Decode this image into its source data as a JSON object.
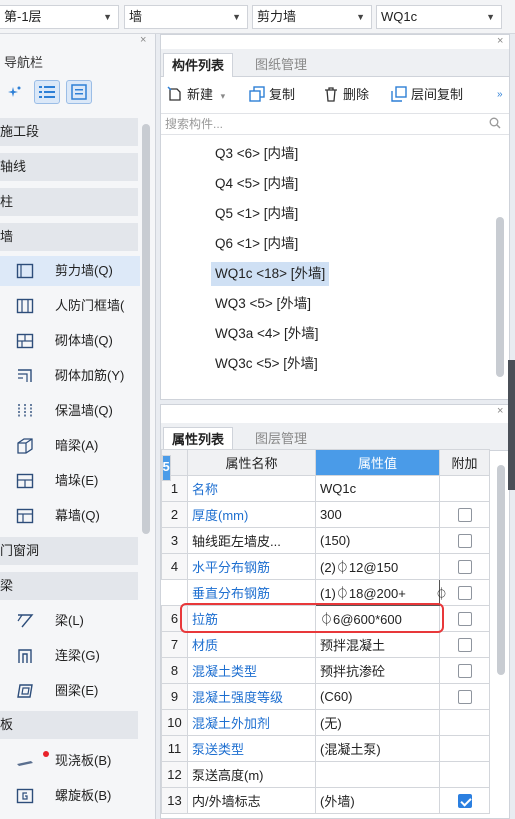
{
  "toolbar": {
    "floor": "第-1层",
    "category": "墙",
    "type": "剪力墙",
    "component": "WQ1c"
  },
  "nav": {
    "title": "导航栏",
    "close": "×",
    "tools": [
      "sparkle-icon",
      "list-icon",
      "detail-list-icon"
    ],
    "groups": [
      {
        "label": "施工段",
        "items": []
      },
      {
        "label": "轴线",
        "items": []
      },
      {
        "label": "柱",
        "items": []
      },
      {
        "label": "墙",
        "items": [
          {
            "label": "剪力墙(Q)",
            "icon": "shear-wall-icon",
            "active": true
          },
          {
            "label": "人防门框墙(",
            "icon": "blast-door-wall-icon"
          },
          {
            "label": "砌体墙(Q)",
            "icon": "masonry-wall-icon"
          },
          {
            "label": "砌体加筋(Y)",
            "icon": "masonry-rebar-icon"
          },
          {
            "label": "保温墙(Q)",
            "icon": "insulation-wall-icon"
          },
          {
            "label": "暗梁(A)",
            "icon": "hidden-beam-icon"
          },
          {
            "label": "墙垛(E)",
            "icon": "wall-pier-icon"
          },
          {
            "label": "幕墙(Q)",
            "icon": "curtain-wall-icon"
          }
        ]
      },
      {
        "label": "门窗洞",
        "items": []
      },
      {
        "label": "梁",
        "items": [
          {
            "label": "梁(L)",
            "icon": "beam-icon"
          },
          {
            "label": "连梁(G)",
            "icon": "coupling-beam-icon"
          },
          {
            "label": "圈梁(E)",
            "icon": "ring-beam-icon"
          }
        ]
      },
      {
        "label": "板",
        "items": [
          {
            "label": "现浇板(B)",
            "icon": "cast-slab-icon"
          },
          {
            "label": "螺旋板(B)",
            "icon": "spiral-slab-icon"
          }
        ]
      }
    ]
  },
  "components": {
    "tabs": [
      "构件列表",
      "图纸管理"
    ],
    "tools": {
      "new": "新建",
      "copy": "复制",
      "delete": "删除",
      "floor_copy": "层间复制"
    },
    "search_placeholder": "搜索构件...",
    "items": [
      {
        "label": "Q3 <6> [内墙]"
      },
      {
        "label": "Q4 <5> [内墙]"
      },
      {
        "label": "Q5 <1> [内墙]"
      },
      {
        "label": "Q6 <1> [内墙]"
      },
      {
        "label": "WQ1c <18> [外墙]",
        "active": true
      },
      {
        "label": "WQ3 <5> [外墙]"
      },
      {
        "label": "WQ3a <4> [外墙]"
      },
      {
        "label": "WQ3c <5> [外墙]"
      }
    ]
  },
  "properties": {
    "tabs": [
      "属性列表",
      "图层管理"
    ],
    "headers": [
      "属性名称",
      "属性值",
      "附加"
    ],
    "rows": [
      {
        "num": "1",
        "name": "名称",
        "value": "WQ1c",
        "blue": true,
        "check": null
      },
      {
        "num": "2",
        "name": "厚度(mm)",
        "value": "300",
        "blue": true,
        "check": false
      },
      {
        "num": "3",
        "name": "轴线距左墙皮...",
        "value": "(150)",
        "blue": false,
        "check": false
      },
      {
        "num": "4",
        "name": "水平分布钢筋",
        "value": "(2)⏀12@150",
        "blue": true,
        "check": false
      },
      {
        "num": "5",
        "name": "垂直分布钢筋",
        "value": "(1)⏀18@200+",
        "blue": true,
        "check": false,
        "extra": "⏀",
        "selected": true
      },
      {
        "num": "6",
        "name": "拉筋",
        "value": "⏀6@600*600",
        "blue": true,
        "check": false
      },
      {
        "num": "7",
        "name": "材质",
        "value": "预拌混凝土",
        "blue": true,
        "check": false
      },
      {
        "num": "8",
        "name": "混凝土类型",
        "value": "预拌抗渗砼",
        "blue": true,
        "check": false
      },
      {
        "num": "9",
        "name": "混凝土强度等级",
        "value": "(C60)",
        "blue": true,
        "check": false
      },
      {
        "num": "10",
        "name": "混凝土外加剂",
        "value": "(无)",
        "blue": true,
        "check": null
      },
      {
        "num": "11",
        "name": "泵送类型",
        "value": "(混凝土泵)",
        "blue": true,
        "check": null
      },
      {
        "num": "12",
        "name": "泵送高度(m)",
        "value": "",
        "blue": false,
        "check": null
      },
      {
        "num": "13",
        "name": "内/外墙标志",
        "value": "(外墙)",
        "blue": false,
        "check": true
      }
    ]
  },
  "colors": {
    "accent": "#4a9be8",
    "highlight": "#e8383a",
    "link": "#1e6fd0"
  }
}
